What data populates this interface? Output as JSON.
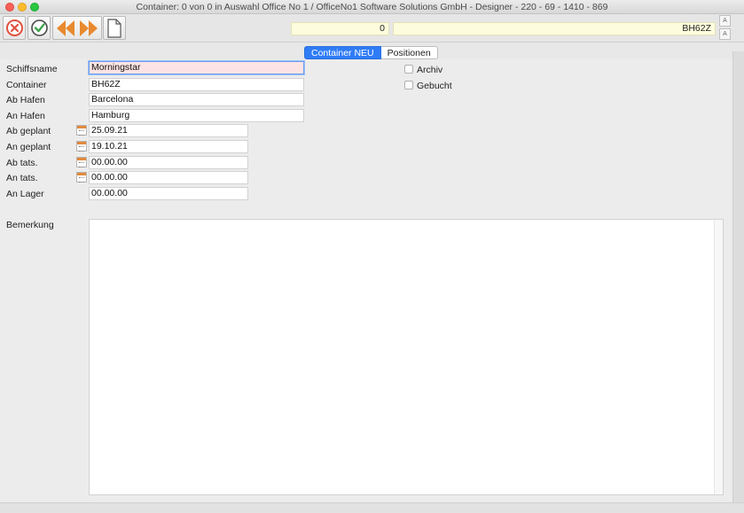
{
  "window": {
    "title": "Container: 0 von 0 in Auswahl Office No 1 /  OfficeNo1 Software Solutions GmbH - Designer - 220 - 69 - 1410 - 869"
  },
  "toolbar": {
    "cancel_icon": "cancel-circle-icon",
    "ok_icon": "check-circle-icon",
    "prev_icon": "arrow-left-icon",
    "next_icon": "arrow-right-icon",
    "new_icon": "new-document-icon"
  },
  "header": {
    "record_number": "0",
    "record_code": "BH62Z",
    "font_up_label": "A",
    "font_down_label": "A"
  },
  "tabs": [
    {
      "label": "Container NEU",
      "active": true
    },
    {
      "label": "Positionen",
      "active": false
    }
  ],
  "form": {
    "schiffsname": {
      "label": "Schiffsname",
      "value": "Morningstar"
    },
    "container": {
      "label": "Container",
      "value": "BH62Z"
    },
    "ab_hafen": {
      "label": "Ab Hafen",
      "value": "Barcelona"
    },
    "an_hafen": {
      "label": "An Hafen",
      "value": "Hamburg"
    },
    "ab_geplant": {
      "label": "Ab geplant",
      "value": "25.09.21"
    },
    "an_geplant": {
      "label": "An geplant",
      "value": "19.10.21"
    },
    "ab_tats": {
      "label": "Ab tats.",
      "value": "00.00.00"
    },
    "an_tats": {
      "label": "An tats.",
      "value": "00.00.00"
    },
    "an_lager": {
      "label": "An Lager",
      "value": "00.00.00"
    },
    "bemerkung": {
      "label": "Bemerkung",
      "value": ""
    }
  },
  "checkboxes": {
    "archiv": {
      "label": "Archiv",
      "checked": false
    },
    "gebucht": {
      "label": "Gebucht",
      "checked": false
    }
  },
  "colors": {
    "accent_tab": "#2f7cf6",
    "focused_field": "#fde4e4",
    "header_field": "#fdfcdc",
    "cancel_red": "#e0533f",
    "ok_green": "#3fa34d",
    "nav_orange": "#e8892f"
  }
}
